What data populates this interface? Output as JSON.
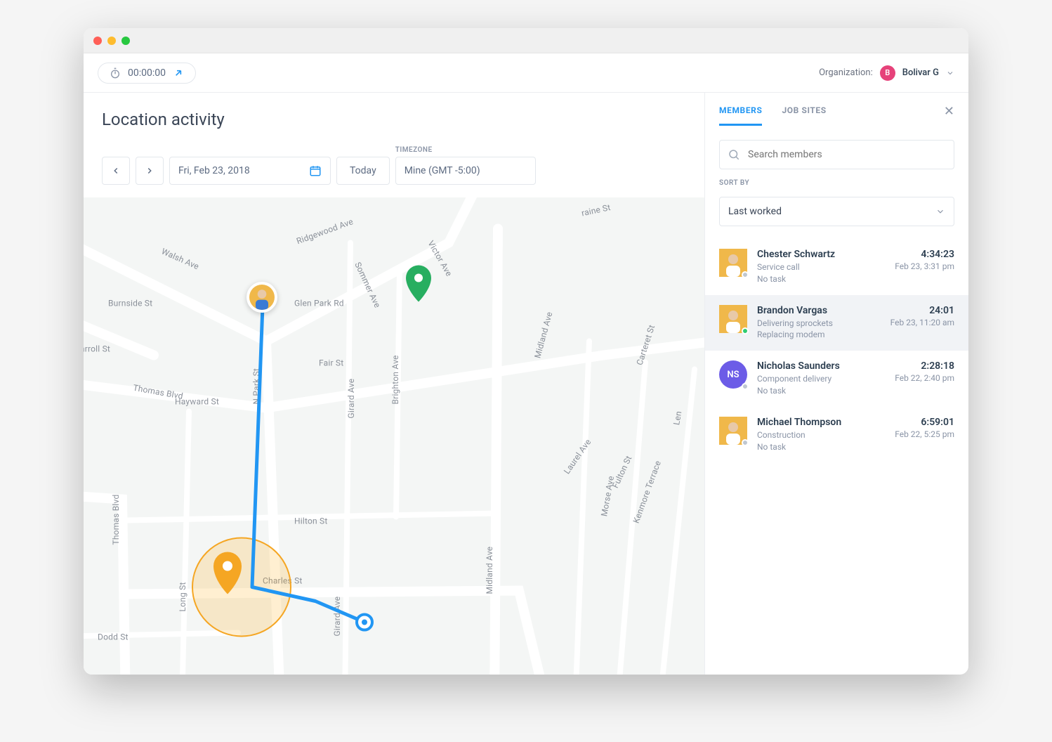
{
  "topbar": {
    "timer": "00:00:00",
    "org_label": "Organization:",
    "org_avatar_letter": "B",
    "org_name": "Bolivar G"
  },
  "page": {
    "title": "Location activity",
    "date": "Fri, Feb 23, 2018",
    "today_label": "Today",
    "timezone_label": "TIMEZONE",
    "timezone_value": "Mine (GMT -5:00)"
  },
  "map": {
    "streets": [
      "Walsh Ave",
      "Burnside St",
      "arroll St",
      "Thomas Blvd",
      "Thomas Blvd",
      "Hayward St",
      "Ridgewood Ave",
      "Sommer Ave",
      "Victor Ave",
      "Glen Park Rd",
      "Fair St",
      "Girard Ave",
      "Brighton Ave",
      "Midland Ave",
      "N Park St",
      "Hilton St",
      "Long St",
      "Charles St",
      "Dodd St",
      "Girard Ave",
      "Midland Ave",
      "Carteret St",
      "Laurel Ave",
      "Len",
      "raine St",
      "Fulton St",
      "Morse Ave",
      "Kenmore Terrace"
    ]
  },
  "sidebar": {
    "tabs": [
      "MEMBERS",
      "JOB SITES"
    ],
    "active_tab": 0,
    "search_placeholder": "Search members",
    "sort_label": "SORT BY",
    "sort_value": "Last worked",
    "members": [
      {
        "name": "Chester Schwartz",
        "line1": "Service call",
        "line2": "No task",
        "time": "4:34:23",
        "date": "Feb 23, 3:31 pm",
        "avatar_bg": "#f0b84a",
        "avatar_type": "photo",
        "status": "#bfc7d1",
        "selected": false
      },
      {
        "name": "Brandon Vargas",
        "line1": "Delivering sprockets",
        "line2": "Replacing modem",
        "time": "24:01",
        "date": "Feb 23, 11:20 am",
        "avatar_bg": "#f0b84a",
        "avatar_type": "photo",
        "status": "#2ecc71",
        "selected": true
      },
      {
        "name": "Nicholas Saunders",
        "line1": "Component delivery",
        "line2": "No task",
        "time": "2:28:18",
        "date": "Feb 22, 2:40 pm",
        "avatar_bg": "#6c5ce7",
        "avatar_type": "initials",
        "initials": "NS",
        "status": "#bfc7d1",
        "selected": false
      },
      {
        "name": "Michael Thompson",
        "line1": "Construction",
        "line2": "No task",
        "time": "6:59:01",
        "date": "Feb 22, 5:25 pm",
        "avatar_bg": "#f0b84a",
        "avatar_type": "photo",
        "status": "#bfc7d1",
        "selected": false
      }
    ]
  }
}
